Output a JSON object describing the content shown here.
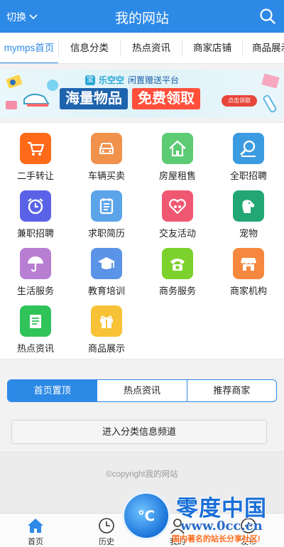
{
  "header": {
    "switch_label": "切换",
    "title": "我的网站"
  },
  "nav": {
    "items": [
      "mymps首页",
      "信息分类",
      "热点资讯",
      "商家店铺",
      "商品展示"
    ]
  },
  "banner": {
    "brand": "乐空空",
    "slogan": "闲置赠送平台",
    "headline_a": "海量物品",
    "headline_b": "免费领取",
    "button": "点击领取"
  },
  "categories": [
    {
      "label": "二手转让",
      "color": "#ff6a1a",
      "icon": "cart-icon"
    },
    {
      "label": "车辆买卖",
      "color": "#f0924c",
      "icon": "car-icon"
    },
    {
      "label": "房屋租售",
      "color": "#5ccb74",
      "icon": "house-icon"
    },
    {
      "label": "全职招聘",
      "color": "#3b9be0",
      "icon": "search-person-icon"
    },
    {
      "label": "兼职招聘",
      "color": "#5a63e8",
      "icon": "clock-icon"
    },
    {
      "label": "求职简历",
      "color": "#5ba4ea",
      "icon": "notepad-icon"
    },
    {
      "label": "交友活动",
      "color": "#f05872",
      "icon": "heart-people-icon"
    },
    {
      "label": "宠物",
      "color": "#22a673",
      "icon": "dog-icon"
    },
    {
      "label": "生活服务",
      "color": "#b77ed2",
      "icon": "umbrella-icon"
    },
    {
      "label": "教育培训",
      "color": "#5b93e6",
      "icon": "graduation-cap-icon"
    },
    {
      "label": "商务服务",
      "color": "#7cd12c",
      "icon": "telephone-icon"
    },
    {
      "label": "商家机构",
      "color": "#f5883e",
      "icon": "shop-icon"
    },
    {
      "label": "热点资讯",
      "color": "#2fc35a",
      "icon": "news-icon"
    },
    {
      "label": "商品展示",
      "color": "#f7c235",
      "icon": "gift-icon"
    }
  ],
  "tabs": [
    "首页置顶",
    "热点资讯",
    "推荐商家"
  ],
  "enter_button": "进入分类信息频道",
  "copyright": "©copyright我的网站",
  "bottom_nav": [
    "首页",
    "历史",
    "我的",
    "发布"
  ],
  "watermark": {
    "title": "零度中国",
    "url": "www.0cc.cn",
    "tagline": "国内著名的站长分享社区!",
    "badge": "℃"
  },
  "colors": {
    "primary": "#2d89e6"
  }
}
